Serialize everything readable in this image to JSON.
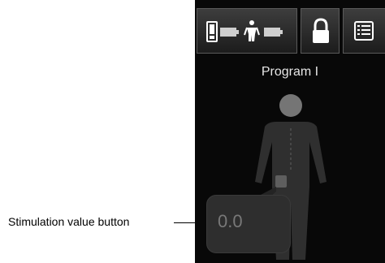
{
  "annotation": {
    "label": "Stimulation value button"
  },
  "screen": {
    "program_title": "Program I",
    "stimulation_value": "0.0"
  },
  "toolbar": {
    "status_icons": [
      "device-battery-icon",
      "patient-figure-icon",
      "battery-icon"
    ],
    "lock_icon": "lock-icon",
    "menu_icon": "list-menu-icon"
  }
}
